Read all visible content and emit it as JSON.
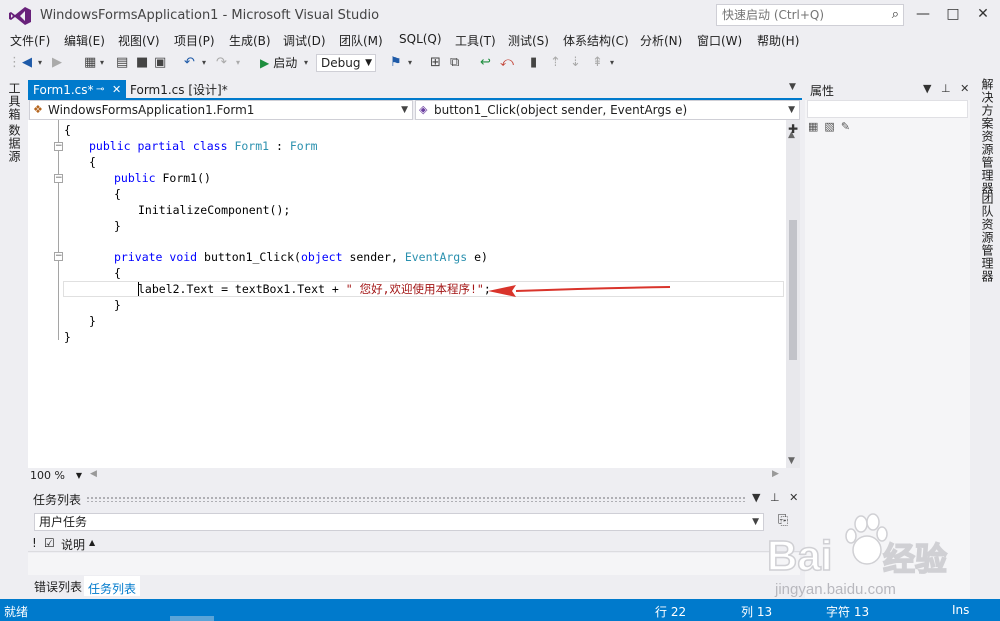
{
  "window": {
    "title": "WindowsFormsApplication1 - Microsoft Visual Studio",
    "quick_launch_placeholder": "快速启动 (Ctrl+Q)"
  },
  "menu": {
    "items": [
      "文件(F)",
      "编辑(E)",
      "视图(V)",
      "项目(P)",
      "生成(B)",
      "调试(D)",
      "团队(M)",
      "SQL(Q)",
      "工具(T)",
      "测试(S)",
      "体系结构(C)",
      "分析(N)",
      "窗口(W)",
      "帮助(H)"
    ]
  },
  "toolbar": {
    "start_label": "启动",
    "config_value": "Debug"
  },
  "side_tabs": {
    "left": [
      "工具箱",
      "数据源"
    ],
    "right": [
      "解决方案资源管理器",
      "团队资源管理器"
    ]
  },
  "document_tabs": {
    "active": "Form1.cs*",
    "inactive": "Form1.cs [设计]*"
  },
  "nav": {
    "class_dropdown": "WindowsFormsApplication1.Form1",
    "member_dropdown": "button1_Click(object sender, EventArgs e)"
  },
  "code": {
    "l1": "{",
    "l2_kw1": "public",
    "l2_kw2": "partial",
    "l2_kw3": "class",
    "l2_ty1": "Form1",
    "l2_sep": " : ",
    "l2_ty2": "Form",
    "l3": "{",
    "l4_kw": "public",
    "l4_rest": " Form1()",
    "l5": "{",
    "l6": "InitializeComponent();",
    "l7": "}",
    "l8_kw1": "private",
    "l8_kw2": "void",
    "l8_mid": " button1_Click(",
    "l8_kw3": "object",
    "l8_mid2": " sender, ",
    "l8_ty": "EventArgs",
    "l8_end": " e)",
    "l9": "{",
    "l10_code": "label2.Text = textBox1.Text + ",
    "l10_str": "\" 您好,欢迎使用本程序!\"",
    "l10_end": ";",
    "l11": "}",
    "l12": "}",
    "l13": "}"
  },
  "editor": {
    "zoom": "100 %"
  },
  "task_list": {
    "title": "任务列表",
    "filter_value": "用户任务",
    "col_priority": "!",
    "col_description": "说明",
    "tab_error": "错误列表",
    "tab_task": "任务列表"
  },
  "properties": {
    "title": "属性"
  },
  "status": {
    "ready": "就绪",
    "line": "行 22",
    "col": "列 13",
    "char": "字符 13",
    "ins": "Ins"
  },
  "watermark": {
    "brand": "Bai",
    "brand_cn": "经验",
    "url": "jingyan.baidu.com"
  },
  "colors": {
    "accent": "#007acc",
    "keyword": "#0000ff",
    "type": "#2b91af",
    "string": "#a31515",
    "arrow": "#d9342b"
  }
}
